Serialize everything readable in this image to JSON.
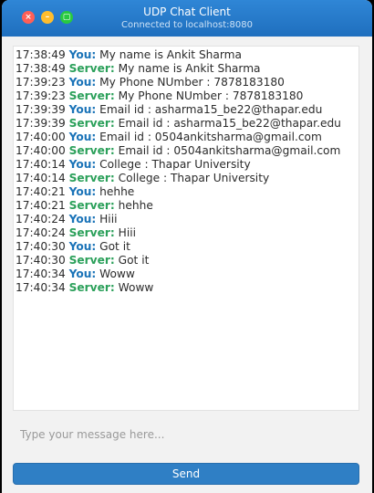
{
  "window": {
    "title": "UDP Chat Client",
    "subtitle": "Connected to localhost:8080",
    "controls": {
      "close_glyph": "×",
      "minimize_glyph": "–",
      "maximize_glyph": "▢"
    }
  },
  "colors": {
    "titlebar": "#2f86d6",
    "you": "#1a73b8",
    "server": "#2ba05a",
    "send_button": "#2f7fc5"
  },
  "messages": [
    {
      "time": "17:38:49",
      "sender": "You:",
      "role": "you",
      "text": "My name is Ankit Sharma"
    },
    {
      "time": "17:38:49",
      "sender": "Server:",
      "role": "server",
      "text": "My name is Ankit Sharma"
    },
    {
      "time": "17:39:23",
      "sender": "You:",
      "role": "you",
      "text": "My Phone NUmber : 7878183180"
    },
    {
      "time": "17:39:23",
      "sender": "Server:",
      "role": "server",
      "text": "My Phone NUmber : 7878183180"
    },
    {
      "time": "17:39:39",
      "sender": "You:",
      "role": "you",
      "text": "Email id : asharma15_be22@thapar.edu"
    },
    {
      "time": "17:39:39",
      "sender": "Server:",
      "role": "server",
      "text": "Email id : asharma15_be22@thapar.edu"
    },
    {
      "time": "17:40:00",
      "sender": "You:",
      "role": "you",
      "text": "Email id : 0504ankitsharma@gmail.com"
    },
    {
      "time": "17:40:00",
      "sender": "Server:",
      "role": "server",
      "text": "Email id : 0504ankitsharma@gmail.com"
    },
    {
      "time": "17:40:14",
      "sender": "You:",
      "role": "you",
      "text": "College : Thapar University"
    },
    {
      "time": "17:40:14",
      "sender": "Server:",
      "role": "server",
      "text": "College : Thapar University"
    },
    {
      "time": "17:40:21",
      "sender": "You:",
      "role": "you",
      "text": "hehhe"
    },
    {
      "time": "17:40:21",
      "sender": "Server:",
      "role": "server",
      "text": "hehhe"
    },
    {
      "time": "17:40:24",
      "sender": "You:",
      "role": "you",
      "text": "Hiii"
    },
    {
      "time": "17:40:24",
      "sender": "Server:",
      "role": "server",
      "text": "Hiii"
    },
    {
      "time": "17:40:30",
      "sender": "You:",
      "role": "you",
      "text": "Got it"
    },
    {
      "time": "17:40:30",
      "sender": "Server:",
      "role": "server",
      "text": "Got it"
    },
    {
      "time": "17:40:34",
      "sender": "You:",
      "role": "you",
      "text": "Woww"
    },
    {
      "time": "17:40:34",
      "sender": "Server:",
      "role": "server",
      "text": "Woww"
    }
  ],
  "composer": {
    "placeholder": "Type your message here...",
    "value": "",
    "send_label": "Send"
  }
}
